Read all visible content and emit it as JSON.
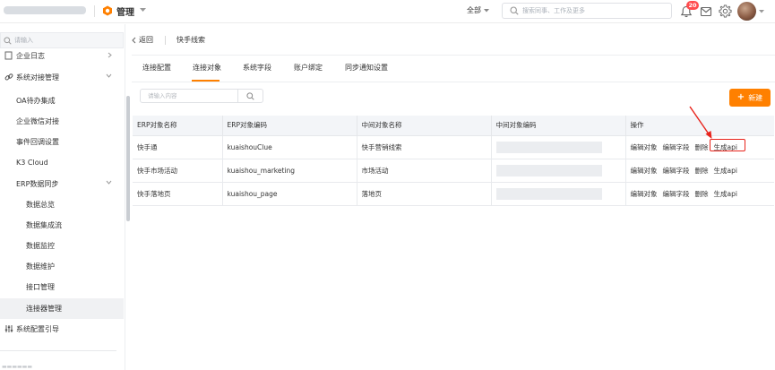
{
  "topbar": {
    "app_title": "管理",
    "scope_label": "全部",
    "search_placeholder": "搜索同事、工作及更多",
    "notification_count": "20",
    "icons": [
      "app-logo-icon",
      "search-icon",
      "bell-icon",
      "message-icon",
      "gear-icon",
      "avatar"
    ]
  },
  "sidebar": {
    "search_placeholder": "请输入",
    "items": [
      {
        "label": "企业日志",
        "level": 0,
        "arrow": "right"
      },
      {
        "label": "系统对接管理",
        "level": 0,
        "arrow": "down",
        "icon": "link-icon"
      },
      {
        "label": "OA待办集成",
        "level": 1
      },
      {
        "label": "企业微信对接",
        "level": 1
      },
      {
        "label": "事件回调设置",
        "level": 1
      },
      {
        "label": "K3 Cloud",
        "level": 1
      },
      {
        "label": "ERP数据同步",
        "level": 1,
        "arrow": "down"
      },
      {
        "label": "数据总览",
        "level": 2
      },
      {
        "label": "数据集成流",
        "level": 2
      },
      {
        "label": "数据监控",
        "level": 2
      },
      {
        "label": "数据维护",
        "level": 2
      },
      {
        "label": "接口管理",
        "level": 2
      },
      {
        "label": "连接器管理",
        "level": 2,
        "active": true
      },
      {
        "label": "系统配置引导",
        "level": 0,
        "icon": "sliders-icon"
      }
    ]
  },
  "breadcrumb": {
    "back_label": "返回",
    "current": "快手线索"
  },
  "tabs": [
    {
      "label": "连接配置",
      "active": false
    },
    {
      "label": "连接对象",
      "active": true
    },
    {
      "label": "系统字段",
      "active": false
    },
    {
      "label": "账户绑定",
      "active": false
    },
    {
      "label": "同步通知设置",
      "active": false
    }
  ],
  "toolbar": {
    "search_placeholder": "请输入内容",
    "new_label": "新建"
  },
  "table": {
    "columns": [
      "ERP对象名称",
      "ERP对象编码",
      "中间对象名称",
      "中间对象编码",
      "操作"
    ],
    "rows": [
      {
        "erp_name": "快手通",
        "erp_code": "kuaishouClue",
        "mid_name": "快手营销线索",
        "mid_code": ""
      },
      {
        "erp_name": "快手市场活动",
        "erp_code": "kuaishou_marketing",
        "mid_name": "市场活动",
        "mid_code": ""
      },
      {
        "erp_name": "快手落地页",
        "erp_code": "kuaishou_page",
        "mid_name": "落地页",
        "mid_code": ""
      }
    ],
    "actions": [
      "编辑对象",
      "编辑字段",
      "删除",
      "生成api"
    ]
  },
  "annotation": {
    "color": "#e8241c",
    "target": "生成api"
  },
  "colors": {
    "accent": "#ff8000",
    "link": "#1a6ee8",
    "badge": "#ff4d4f"
  }
}
